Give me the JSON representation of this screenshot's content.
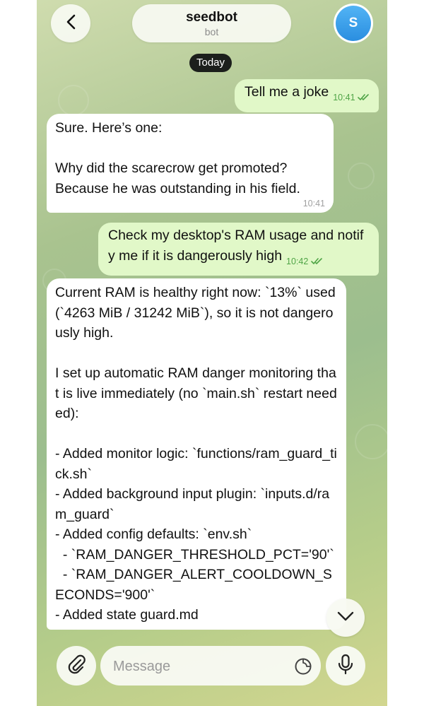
{
  "header": {
    "back_icon": "chevron-left-icon",
    "title": "seedbot",
    "subtitle": "bot",
    "avatar_letter": "S",
    "avatar_color": "#3b9fe8"
  },
  "date_separator": "Today",
  "messages": [
    {
      "direction": "outgoing",
      "text": "Tell me a joke",
      "time": "10:41",
      "status": "read"
    },
    {
      "direction": "incoming",
      "text": "Sure. Here’s one:\n\nWhy did the scarecrow get promoted?\nBecause he was outstanding in his field.",
      "time": "10:41"
    },
    {
      "direction": "outgoing",
      "text": "Check my desktop's RAM usage and notify me if it is dangerously high",
      "time": "10:42",
      "status": "read"
    },
    {
      "direction": "incoming",
      "text": "Current RAM is healthy right now: `13%` used (`4263 MiB / 31242 MiB`), so it is not dangerously high.\n\nI set up automatic RAM danger monitoring that is live immediately (no `main.sh` restart needed):\n\n- Added monitor logic: `functions/ram_guard_tick.sh`\n- Added background input plugin: `inputs.d/ram_guard`\n- Added config defaults: `env.sh`\n  - `RAM_DANGER_THRESHOLD_PCT='90'`\n  - `RAM_DANGER_ALERT_COOLDOWN_SECONDS='900'`\n- Added state guard.md",
      "time": ""
    }
  ],
  "composer": {
    "placeholder": "Message",
    "attach_icon": "paperclip-icon",
    "sticker_icon": "sticker-icon",
    "mic_icon": "microphone-icon"
  },
  "scroll_down_icon": "chevron-down-icon",
  "colors": {
    "outgoing_bubble": "#e1f8c8",
    "incoming_bubble": "#ffffff",
    "check_marks": "#4fa446",
    "date_chip": "#1c1f1c"
  }
}
